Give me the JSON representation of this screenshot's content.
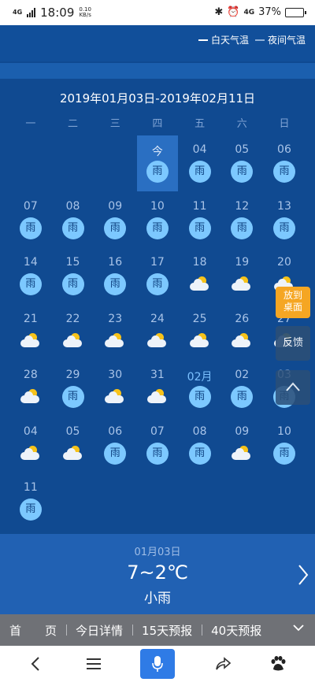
{
  "status": {
    "net_label": "4G",
    "time": "18:09",
    "speed_value": "0.10",
    "speed_unit": "KB/s",
    "net2": "4G",
    "battery": "37%",
    "battery_level": 0.37
  },
  "legend": {
    "day_label": "白天气温",
    "night_label": "夜间气温",
    "day_color": "#ffffff",
    "night_color": "#8fb0d8"
  },
  "calendar": {
    "range": "2019年01月03日-2019年02月11日",
    "weekdays": [
      "一",
      "二",
      "三",
      "四",
      "五",
      "六",
      "日"
    ],
    "rain_label": "雨",
    "cells": [
      {
        "date": "",
        "icon": ""
      },
      {
        "date": "",
        "icon": ""
      },
      {
        "date": "",
        "icon": ""
      },
      {
        "date": "今",
        "icon": "rain",
        "today": true
      },
      {
        "date": "04",
        "icon": "rain"
      },
      {
        "date": "05",
        "icon": "rain"
      },
      {
        "date": "06",
        "icon": "rain"
      },
      {
        "date": "07",
        "icon": "rain"
      },
      {
        "date": "08",
        "icon": "rain"
      },
      {
        "date": "09",
        "icon": "rain"
      },
      {
        "date": "10",
        "icon": "rain"
      },
      {
        "date": "11",
        "icon": "rain"
      },
      {
        "date": "12",
        "icon": "rain"
      },
      {
        "date": "13",
        "icon": "rain"
      },
      {
        "date": "14",
        "icon": "rain"
      },
      {
        "date": "15",
        "icon": "rain"
      },
      {
        "date": "16",
        "icon": "rain"
      },
      {
        "date": "17",
        "icon": "rain"
      },
      {
        "date": "18",
        "icon": "cloudy"
      },
      {
        "date": "19",
        "icon": "cloudy"
      },
      {
        "date": "20",
        "icon": "cloudy"
      },
      {
        "date": "21",
        "icon": "cloudy"
      },
      {
        "date": "22",
        "icon": "cloudy"
      },
      {
        "date": "23",
        "icon": "cloudy"
      },
      {
        "date": "24",
        "icon": "cloudy"
      },
      {
        "date": "25",
        "icon": "cloudy"
      },
      {
        "date": "26",
        "icon": "cloudy"
      },
      {
        "date": "27",
        "icon": "cloudy"
      },
      {
        "date": "28",
        "icon": "cloudy"
      },
      {
        "date": "29",
        "icon": "rain"
      },
      {
        "date": "30",
        "icon": "cloudy"
      },
      {
        "date": "31",
        "icon": "cloudy"
      },
      {
        "date": "02月",
        "icon": "rain",
        "month": true
      },
      {
        "date": "02",
        "icon": "rain"
      },
      {
        "date": "03",
        "icon": "rain"
      },
      {
        "date": "04",
        "icon": "cloudy"
      },
      {
        "date": "05",
        "icon": "cloudy"
      },
      {
        "date": "06",
        "icon": "rain"
      },
      {
        "date": "07",
        "icon": "rain"
      },
      {
        "date": "08",
        "icon": "rain"
      },
      {
        "date": "09",
        "icon": "cloudy"
      },
      {
        "date": "10",
        "icon": "rain"
      },
      {
        "date": "11",
        "icon": "rain"
      }
    ]
  },
  "floating": {
    "fav_line1": "放到",
    "fav_line2": "桌面",
    "feedback": "反馈"
  },
  "summary": {
    "date": "01月03日",
    "temp": "7~2℃",
    "desc": "小雨"
  },
  "tabs": [
    "首　　页",
    "今日详情",
    "15天预报",
    "40天预报"
  ]
}
